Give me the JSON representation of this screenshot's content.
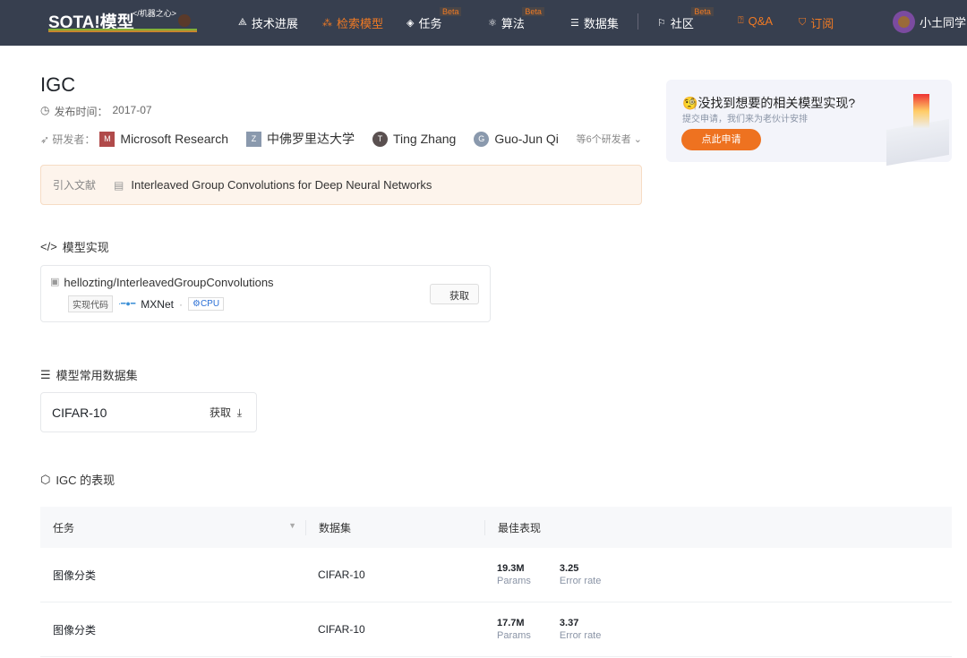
{
  "nav": {
    "logo": "SOTA!模型",
    "logo_sub": "</机器之心>",
    "items": [
      {
        "label": "技术进展",
        "icon": "compass-icon",
        "beta": ""
      },
      {
        "label": "检索模型",
        "icon": "nodes-icon",
        "beta": "",
        "active": true
      },
      {
        "label": "任务",
        "icon": "layers-icon",
        "beta": "Beta"
      },
      {
        "label": "算法",
        "icon": "atom-icon",
        "beta": "Beta"
      },
      {
        "label": "数据集",
        "icon": "database-icon",
        "beta": ""
      },
      {
        "label": "社区",
        "icon": "flag-icon",
        "beta": "Beta"
      },
      {
        "label": "Q&A",
        "icon": "question-icon",
        "beta": ""
      },
      {
        "label": "订阅",
        "icon": "bookmark-icon",
        "beta": ""
      }
    ],
    "user": "小土同学"
  },
  "model": {
    "title": "IGC",
    "date_label": "发布时间：",
    "date": "2017-07",
    "authors_label": "研发者：",
    "authors": [
      {
        "name": "Microsoft Research",
        "initial": "M",
        "color": "#b04a4a"
      },
      {
        "name": "中佛罗里达大学",
        "initial": "Z",
        "color": "#8a99ad"
      },
      {
        "name": "Ting Zhang",
        "initial": "T",
        "color": "#5a5050"
      },
      {
        "name": "Guo-Jun Qi",
        "initial": "G",
        "color": "#8a99ad"
      }
    ],
    "more_authors": "等6个研发者",
    "cite_label": "引入文献",
    "cite_title": "Interleaved Group Convolutions for Deep Neural Networks"
  },
  "impl": {
    "heading": "模型实现",
    "repo": "hellozting/InterleavedGroupConvolutions",
    "tag": "实现代码",
    "framework": "MXNet",
    "device": "CPU",
    "get": "获取"
  },
  "datasets": {
    "heading": "模型常用数据集",
    "items": [
      {
        "name": "CIFAR-10",
        "get": "获取"
      }
    ]
  },
  "perf": {
    "heading": "IGC 的表现",
    "columns": [
      "任务",
      "数据集",
      "最佳表现"
    ],
    "rows": [
      {
        "task": "图像分类",
        "dataset": "CIFAR-10",
        "m1": "19.3M",
        "m1l": "Params",
        "m2": "3.25",
        "m2l": "Error rate"
      },
      {
        "task": "图像分类",
        "dataset": "CIFAR-10",
        "m1": "17.7M",
        "m1l": "Params",
        "m2": "3.37",
        "m2l": "Error rate"
      }
    ]
  },
  "promo": {
    "title": "没找到想要的相关模型实现?",
    "subtitle": "提交申请，我们来为老伙计安排",
    "button": "点此申请"
  },
  "colors": {
    "accent": "#f07a24",
    "nav_bg": "#373f4f"
  }
}
